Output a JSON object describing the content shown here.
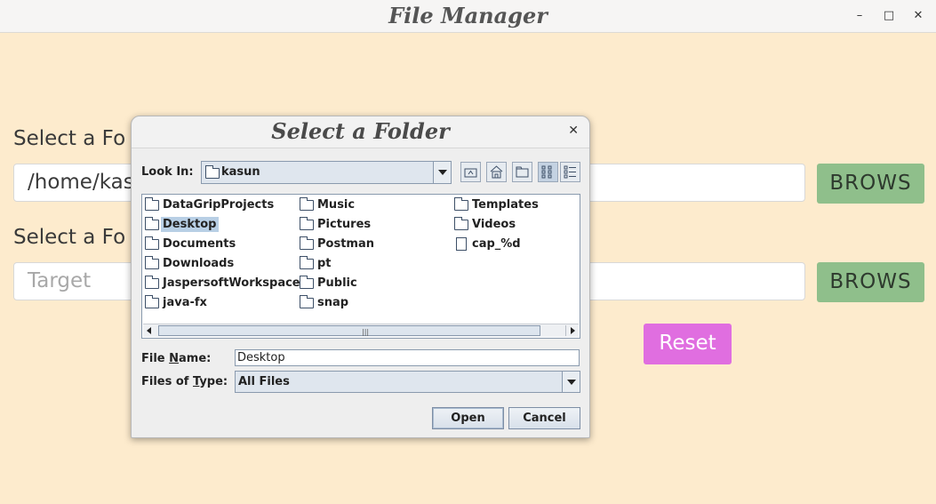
{
  "window": {
    "title": "File Manager",
    "minimize": "–",
    "maximize": "□",
    "close": "✕"
  },
  "form": {
    "source_label": "Select a Fo",
    "source_value": "/home/kas",
    "browse1": "BROWS",
    "target_label": "Select a Fo",
    "target_placeholder": "Target",
    "browse2": "BROWS",
    "reset": "Reset"
  },
  "dialog": {
    "title": "Select a Folder",
    "close": "✕",
    "look_in_label": "Look In:",
    "look_in_value": "kasun",
    "toolbar": [
      "up-folder-icon",
      "home-icon",
      "new-folder-icon",
      "list-view-icon",
      "details-view-icon"
    ],
    "files": [
      {
        "name": "DataGripProjects",
        "type": "folder",
        "selected": false
      },
      {
        "name": "Desktop",
        "type": "folder",
        "selected": true
      },
      {
        "name": "Documents",
        "type": "folder",
        "selected": false
      },
      {
        "name": "Downloads",
        "type": "folder",
        "selected": false
      },
      {
        "name": "JaspersoftWorkspace",
        "type": "folder",
        "selected": false
      },
      {
        "name": "java-fx",
        "type": "folder",
        "selected": false
      },
      {
        "name": "Music",
        "type": "folder",
        "selected": false
      },
      {
        "name": "Pictures",
        "type": "folder",
        "selected": false
      },
      {
        "name": "Postman",
        "type": "folder",
        "selected": false
      },
      {
        "name": "pt",
        "type": "folder",
        "selected": false
      },
      {
        "name": "Public",
        "type": "folder",
        "selected": false
      },
      {
        "name": "snap",
        "type": "folder",
        "selected": false
      },
      {
        "name": "Templates",
        "type": "folder",
        "selected": false
      },
      {
        "name": "Videos",
        "type": "folder",
        "selected": false
      },
      {
        "name": "cap_%d",
        "type": "file",
        "selected": false
      }
    ],
    "file_name_label": "File Name:",
    "file_name_value": "Desktop",
    "files_of_type_label": "Files of Type:",
    "files_of_type_value": "All Files",
    "open_button": "Open",
    "cancel_button": "Cancel"
  },
  "colors": {
    "background": "#fdebcd",
    "browse_button": "#8fbf8b",
    "reset_button": "#e06ee0",
    "selection": "#b8cfe5"
  }
}
